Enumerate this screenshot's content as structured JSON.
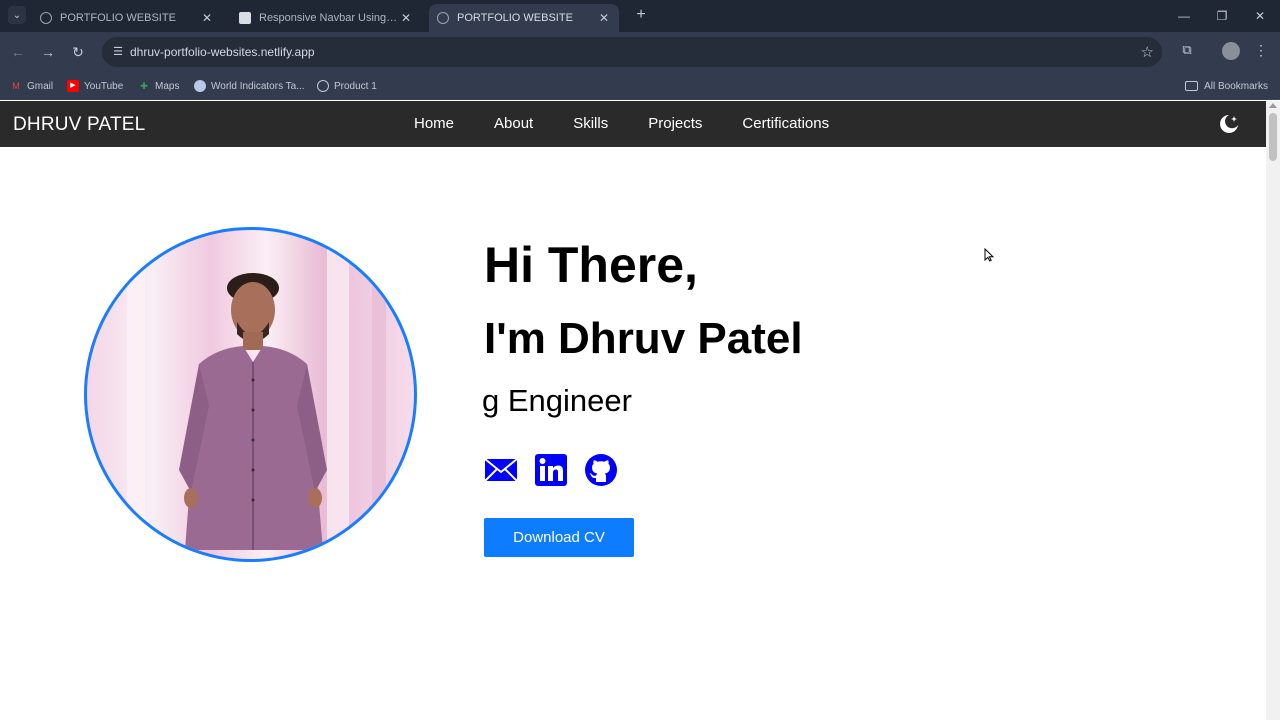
{
  "browser": {
    "tabs": [
      {
        "title": "PORTFOLIO WEBSITE",
        "active": false,
        "icon": "globe-icon"
      },
      {
        "title": "Responsive Navbar Using HTML",
        "active": false,
        "icon": "doc-icon"
      },
      {
        "title": "PORTFOLIO WEBSITE",
        "active": true,
        "icon": "globe-icon"
      }
    ],
    "url": "dhruv-portfolio-websites.netlify.app",
    "bookmarks": [
      {
        "label": "Gmail",
        "icon": "gmail-icon",
        "color": "#ea4335"
      },
      {
        "label": "YouTube",
        "icon": "youtube-icon",
        "color": "#ff0000"
      },
      {
        "label": "Maps",
        "icon": "maps-icon",
        "color": "#34a853"
      },
      {
        "label": "World Indicators Ta...",
        "icon": "globe-icon",
        "color": "#b8c8e8"
      },
      {
        "label": "Product 1",
        "icon": "globe-icon",
        "color": "#c3c9d3"
      }
    ],
    "all_bookmarks": "All Bookmarks"
  },
  "site": {
    "brand": "DHRUV PATEL",
    "nav": [
      "Home",
      "About",
      "Skills",
      "Projects",
      "Certifications"
    ],
    "hero": {
      "greeting": "Hi There,",
      "name": "I'm Dhruv Patel",
      "role": "g Engineer",
      "cta": "Download CV"
    },
    "socials": [
      "email-icon",
      "linkedin-icon",
      "github-icon"
    ],
    "accent": "#0d7cff",
    "icon_color": "#0000ff"
  }
}
